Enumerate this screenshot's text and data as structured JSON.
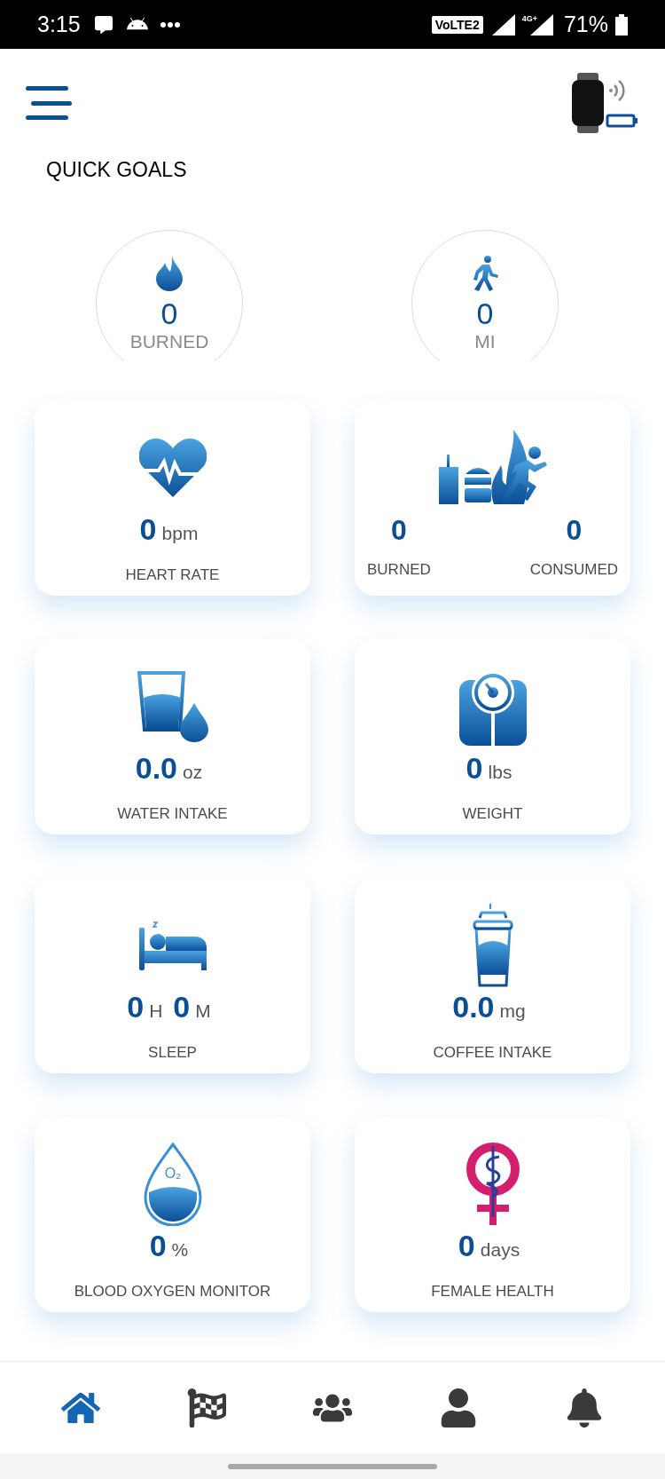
{
  "status_bar": {
    "time": "3:15",
    "network_badge": "VoLTE2",
    "network_type": "4G+",
    "battery": "71%"
  },
  "header": {
    "title": "QUICK GOALS"
  },
  "quick_goals": [
    {
      "value": "0",
      "unit": "BURNED"
    },
    {
      "value": "0",
      "unit": "MI"
    }
  ],
  "cards": [
    {
      "kind": "single",
      "readings": [
        {
          "value": "0",
          "unit": "bpm"
        }
      ],
      "label": "HEART RATE"
    },
    {
      "kind": "split",
      "columns": [
        {
          "value": "0",
          "label": "BURNED"
        },
        {
          "value": "0",
          "label": "CONSUMED"
        }
      ]
    },
    {
      "kind": "single",
      "readings": [
        {
          "value": "0.0",
          "unit": "oz"
        }
      ],
      "label": "WATER INTAKE"
    },
    {
      "kind": "single",
      "readings": [
        {
          "value": "0",
          "unit": "lbs"
        }
      ],
      "label": "WEIGHT"
    },
    {
      "kind": "single",
      "readings": [
        {
          "value": "0",
          "unit": "H"
        },
        {
          "value": "0",
          "unit": "M"
        }
      ],
      "label": "SLEEP"
    },
    {
      "kind": "single",
      "readings": [
        {
          "value": "0.0",
          "unit": "mg"
        }
      ],
      "label": "COFFEE INTAKE"
    },
    {
      "kind": "single",
      "icon_text": "O₂",
      "readings": [
        {
          "value": "0",
          "unit": "%"
        }
      ],
      "label": "BLOOD OXYGEN MONITOR"
    },
    {
      "kind": "single",
      "readings": [
        {
          "value": "0",
          "unit": "days"
        }
      ],
      "label": "FEMALE HEALTH"
    }
  ],
  "bottom_nav": [
    {
      "selected": true
    },
    {
      "selected": false
    },
    {
      "selected": false
    },
    {
      "selected": false
    },
    {
      "selected": false
    }
  ]
}
